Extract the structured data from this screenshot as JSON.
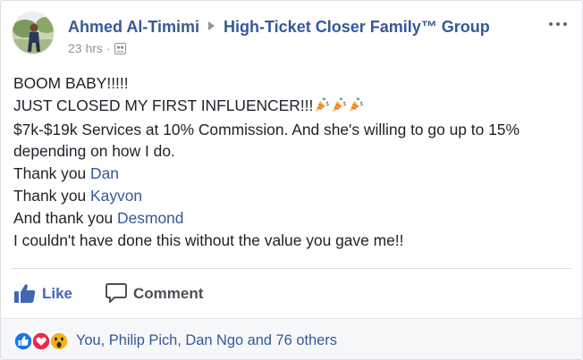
{
  "post": {
    "author": "Ahmed Al-Timimi",
    "group": "High-Ticket Closer Family™ Group",
    "timestamp": "23 hrs",
    "separator": "·",
    "lines": {
      "l1": "BOOM BABY!!!!!",
      "l2": "JUST CLOSED MY FIRST INFLUENCER!!!",
      "l3": "$7k-$19k Services at 10% Commission. And she's willing to go up to 15% depending on how I do.",
      "l4_prefix": "Thank you ",
      "l4_mention": "Dan",
      "l5_prefix": "Thank you ",
      "l5_mention": "Kayvon",
      "l6_prefix": "And thank you ",
      "l6_mention": "Desmond",
      "l7": "I couldn't have done this without the value you gave me!!"
    }
  },
  "actions": {
    "like_label": "Like",
    "comment_label": "Comment"
  },
  "reactions": {
    "summary": "You, Philip Pich, Dan Ngo and 76 others"
  },
  "icons": {
    "like": "thumbs-up-icon",
    "comment": "comment-bubble-icon",
    "more": "more-options-icon",
    "privacy": "group-icon",
    "party": "party-popper-icon"
  },
  "colors": {
    "link": "#365899",
    "like_blue": "#4267b2",
    "meta_gray": "#90949c",
    "reaction_bar_bg": "#f6f7f9"
  }
}
